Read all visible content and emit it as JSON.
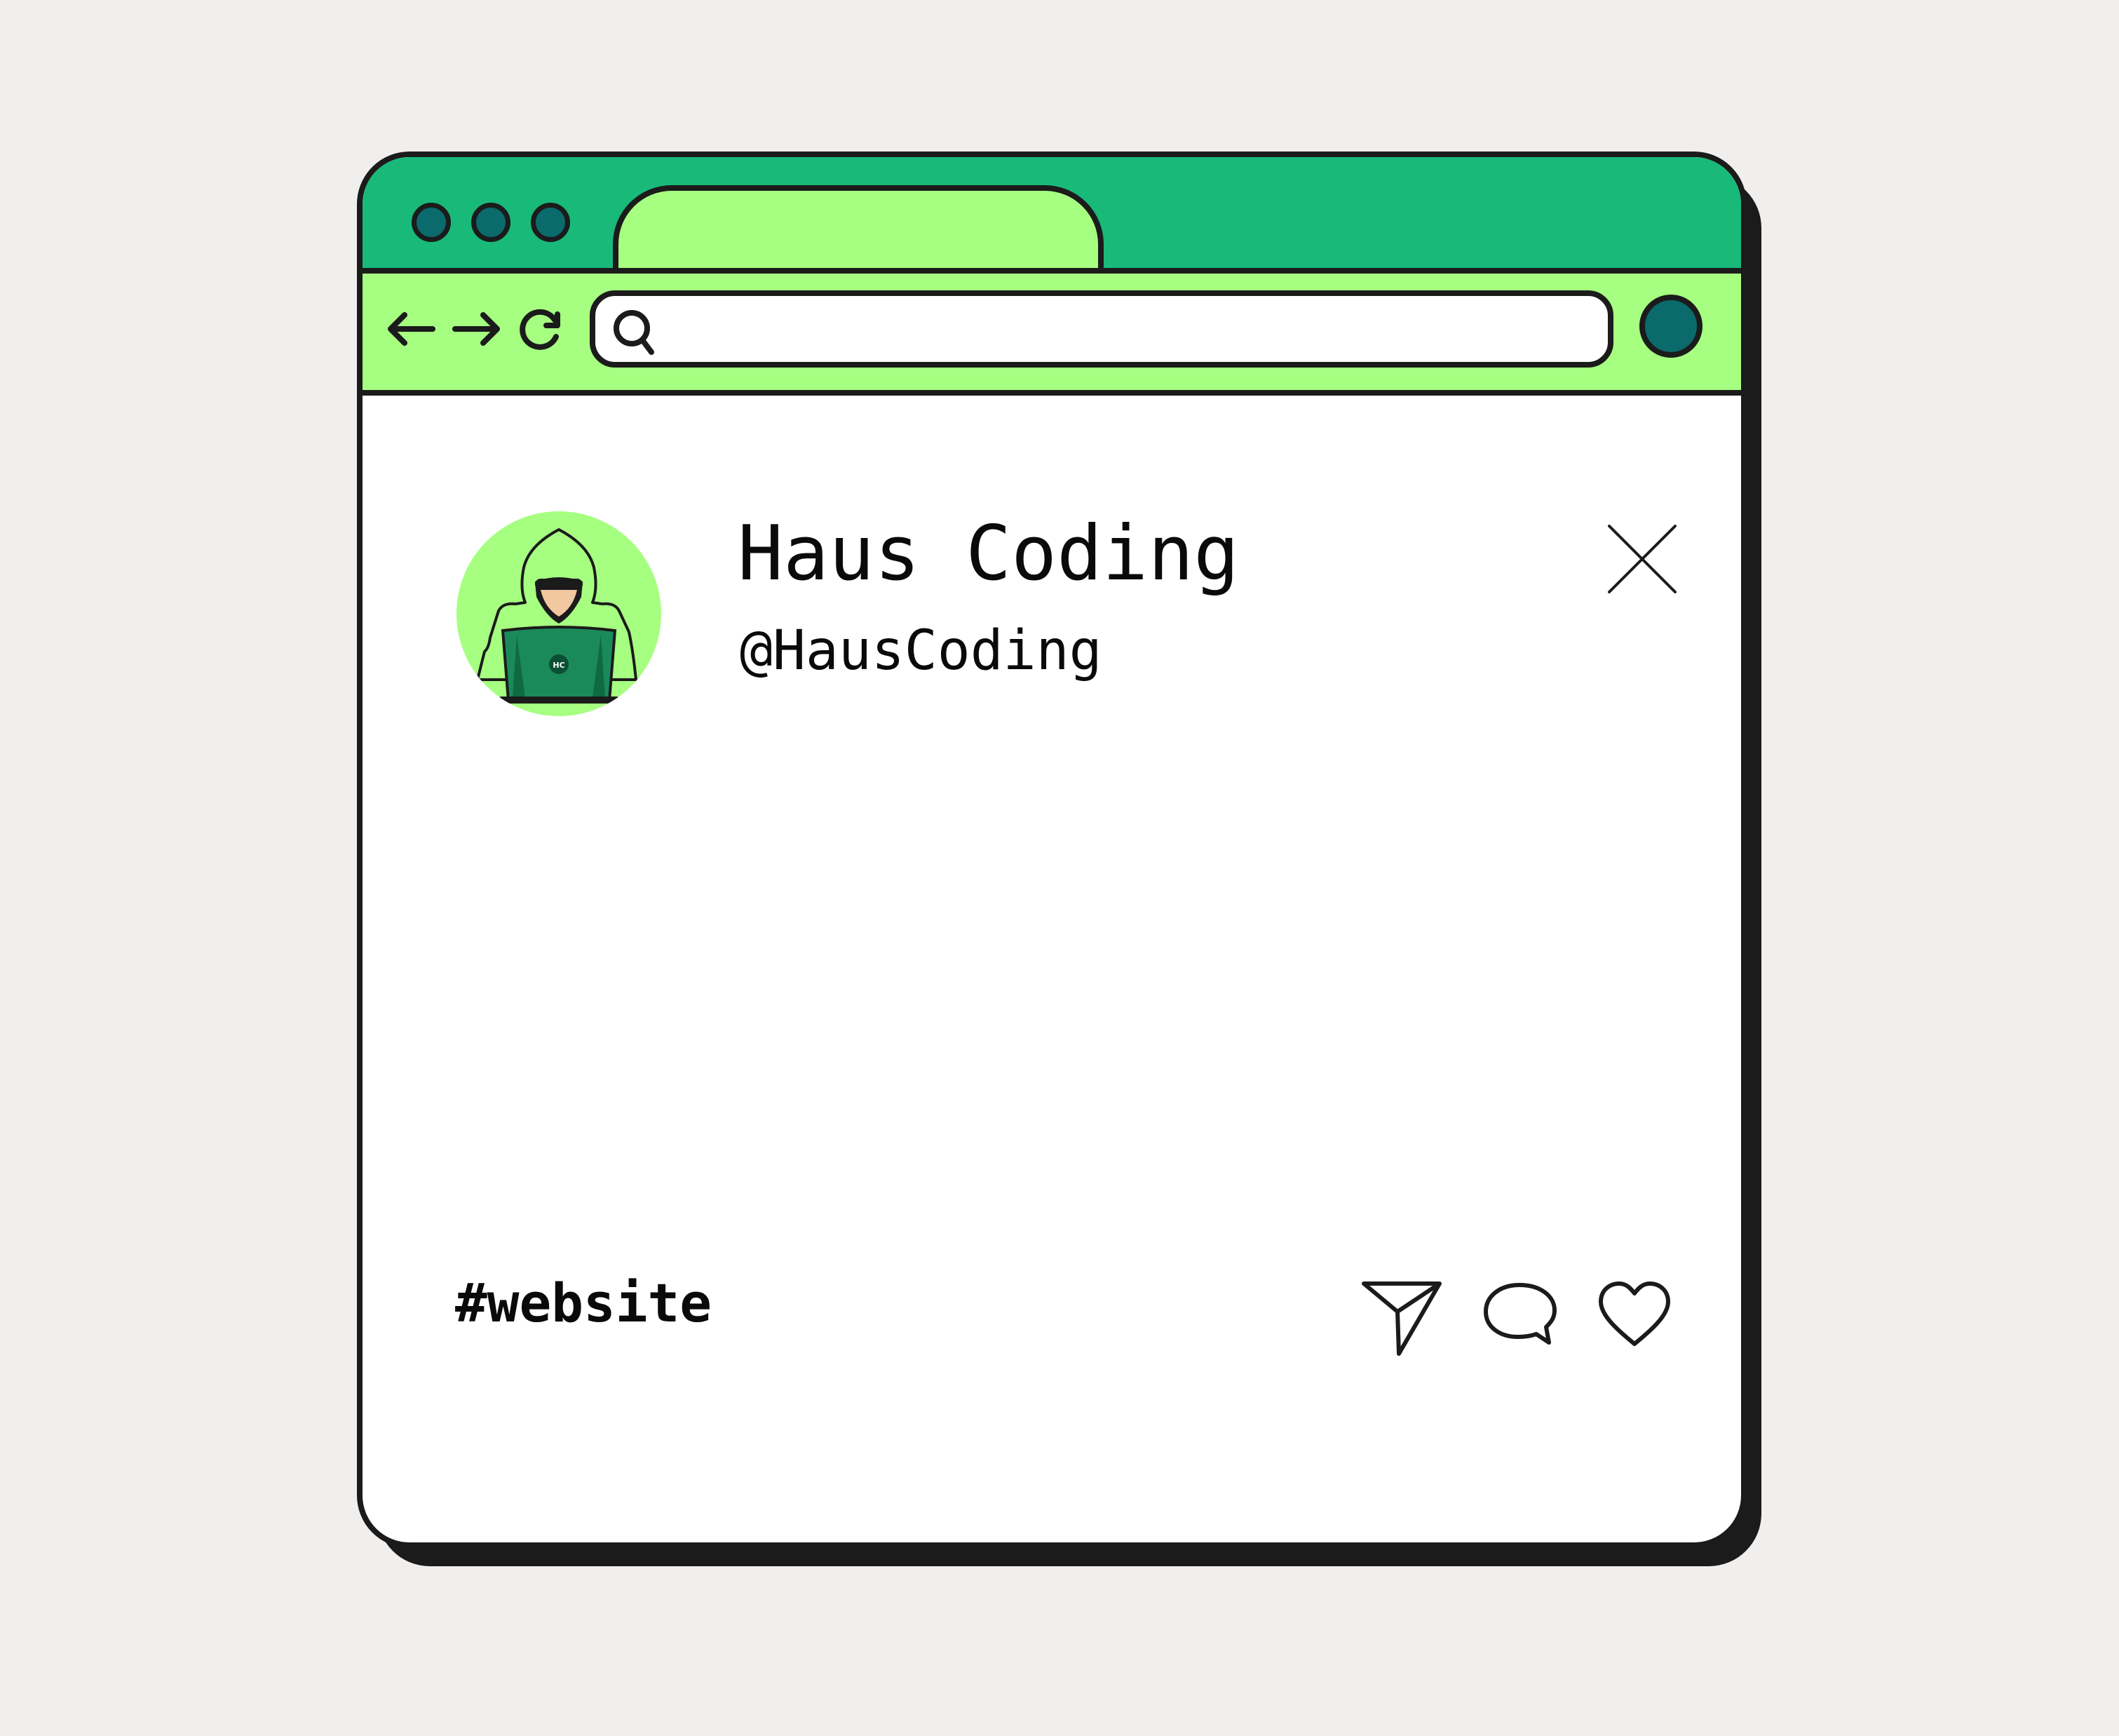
{
  "colors": {
    "page_background": "#f0efed",
    "window_border": "#1b1b1b",
    "titlebar": "#19b97a",
    "toolbar": "#a6ff80",
    "dot": "#0a6a6c",
    "avatar_background": "#a6ff80"
  },
  "browser": {
    "window_dots": [
      "window-dot",
      "window-dot",
      "window-dot"
    ],
    "toolbar": {
      "back_icon": "arrow-left-icon",
      "forward_icon": "arrow-right-icon",
      "reload_icon": "reload-icon",
      "search_icon": "search-icon",
      "url_value": "",
      "profile_icon": "profile-circle-icon"
    }
  },
  "post": {
    "name": "Haus Coding",
    "handle": "@HausCoding",
    "hashtag": "#website",
    "avatar_icon": "hooded-coder-avatar",
    "close_icon": "close-icon",
    "actions": [
      {
        "icon": "send-icon"
      },
      {
        "icon": "comment-icon"
      },
      {
        "icon": "heart-icon"
      }
    ]
  }
}
